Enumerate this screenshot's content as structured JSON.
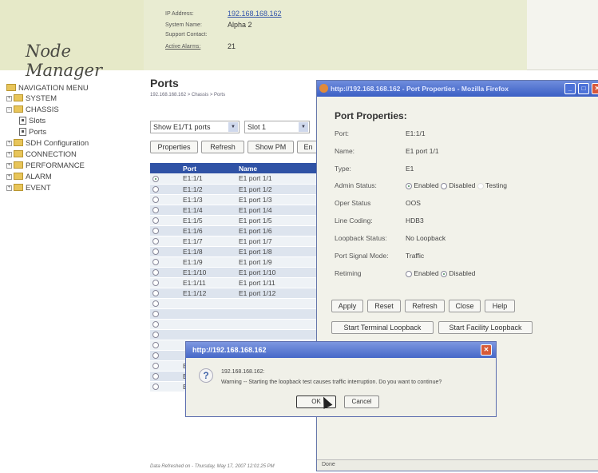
{
  "app": {
    "logo": "Node Manager"
  },
  "sysinfo": {
    "ip_label": "IP Address:",
    "ip_value": "192.168.168.162",
    "system_label": "System Name:",
    "system_value": "Alpha 2",
    "support_label": "Support Contact:",
    "support_value": "",
    "alarms_label": "Active Alarms:",
    "alarms_value": "21"
  },
  "sidebar": {
    "items": [
      {
        "label": "NAVIGATION MENU"
      },
      {
        "label": "SYSTEM"
      },
      {
        "label": "CHASSIS"
      },
      {
        "label": "Slots"
      },
      {
        "label": "Ports"
      },
      {
        "label": "SDH Configuration"
      },
      {
        "label": "CONNECTION"
      },
      {
        "label": "PERFORMANCE"
      },
      {
        "label": "ALARM"
      },
      {
        "label": "EVENT"
      }
    ]
  },
  "main": {
    "title": "Ports",
    "breadcrumb": "192.168.168.162 > Chassis > Ports",
    "filter_select": "Show E1/T1 ports",
    "slot_select": "Slot 1",
    "buttons": {
      "properties": "Properties",
      "refresh": "Refresh",
      "show_pm": "Show PM",
      "en": "En"
    },
    "table": {
      "headers": [
        "",
        "Port",
        "Name"
      ],
      "rows": [
        {
          "port": "E1:1/1",
          "name": "E1 port 1/1"
        },
        {
          "port": "E1:1/2",
          "name": "E1 port 1/2"
        },
        {
          "port": "E1:1/3",
          "name": "E1 port 1/3"
        },
        {
          "port": "E1:1/4",
          "name": "E1 port 1/4"
        },
        {
          "port": "E1:1/5",
          "name": "E1 port 1/5"
        },
        {
          "port": "E1:1/6",
          "name": "E1 port 1/6"
        },
        {
          "port": "E1:1/7",
          "name": "E1 port 1/7"
        },
        {
          "port": "E1:1/8",
          "name": "E1 port 1/8"
        },
        {
          "port": "E1:1/9",
          "name": "E1 port 1/9"
        },
        {
          "port": "E1:1/10",
          "name": "E1 port 1/10"
        },
        {
          "port": "E1:1/11",
          "name": "E1 port 1/11"
        },
        {
          "port": "E1:1/12",
          "name": "E1 port 1/12"
        },
        {
          "port": "",
          "name": ""
        },
        {
          "port": "",
          "name": ""
        },
        {
          "port": "",
          "name": ""
        },
        {
          "port": "",
          "name": ""
        },
        {
          "port": "",
          "name": ""
        },
        {
          "port": "",
          "name": ""
        },
        {
          "port": "E1:1/19",
          "name": "E1 port 1/19"
        },
        {
          "port": "E1:1/20",
          "name": "E1 port 1/20"
        },
        {
          "port": "E1:1/21",
          "name": "E1 port 1/21"
        }
      ]
    },
    "footer": "Data Refreshed on - Thursday, May 17, 2007 12:01:25 PM"
  },
  "popup": {
    "title": "http://192.168.168.162 - Port Properties - Mozilla Firefox",
    "heading": "Port Properties:",
    "port_label": "Port:",
    "port_value": "E1:1/1",
    "name_label": "Name:",
    "name_value": "E1 port 1/1",
    "type_label": "Type:",
    "type_value": "E1",
    "admin_label": "Admin Status:",
    "admin_enabled": "Enabled",
    "admin_disabled": "Disabled",
    "admin_testing": "Testing",
    "oper_label": "Oper Status",
    "oper_value": "OOS",
    "coding_label": "Line Coding:",
    "coding_value": "HDB3",
    "loopback_label": "Loopback Status:",
    "loopback_value": "No Loopback",
    "signal_label": "Port Signal Mode:",
    "signal_value": "Traffic",
    "retiming_label": "Retiming",
    "retiming_enabled": "Enabled",
    "retiming_disabled": "Disabled",
    "buttons": {
      "apply": "Apply",
      "reset": "Reset",
      "refresh": "Refresh",
      "close": "Close",
      "help": "Help",
      "terminal": "Start Terminal Loopback",
      "facility": "Start Facility Loopback"
    },
    "status": "Done"
  },
  "dialog": {
    "title": "http://192.168.168.162",
    "host": "192.168.168.162:",
    "message": "Warning -- Starting the loopback test causes traffic interruption. Do you want to continue?",
    "ok": "OK",
    "cancel": "Cancel"
  }
}
